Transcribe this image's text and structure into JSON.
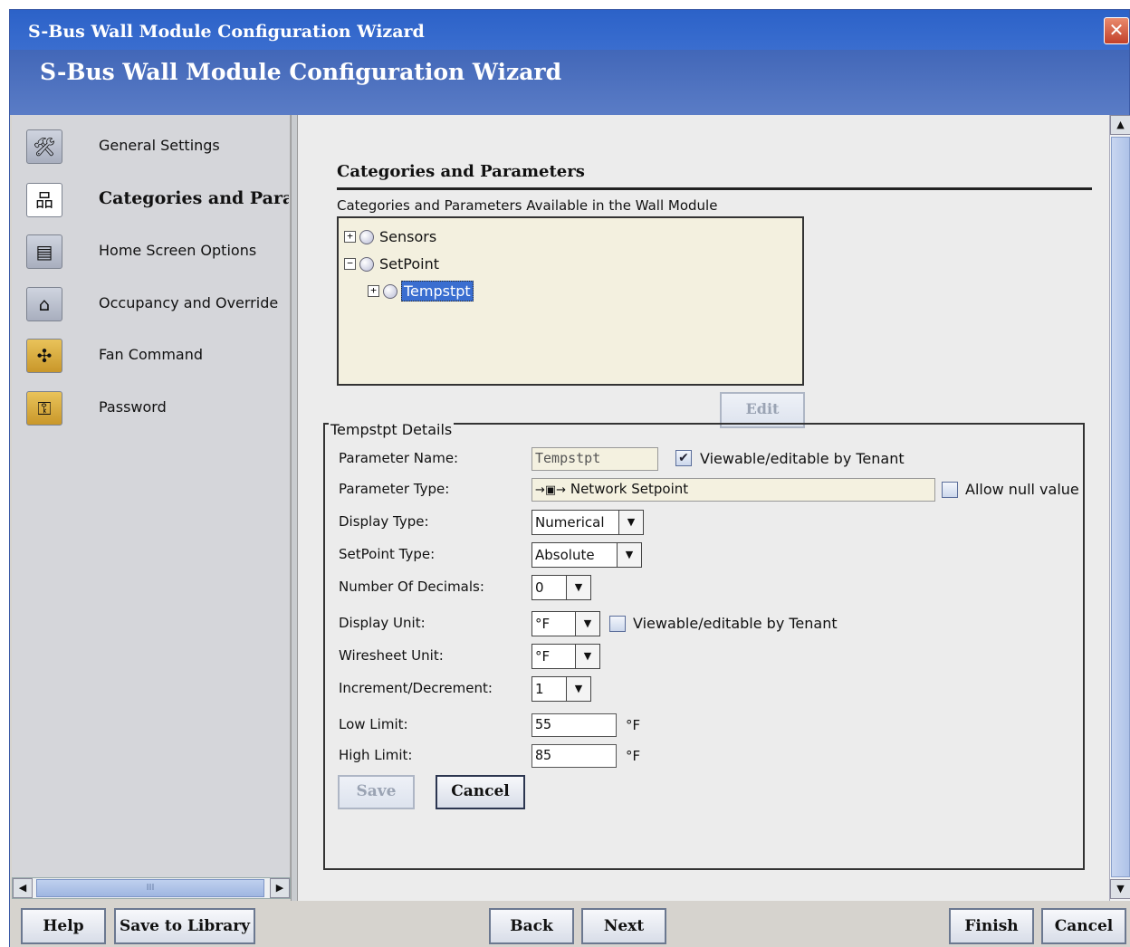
{
  "window": {
    "title": "S-Bus Wall Module Configuration Wizard",
    "header_title": "S-Bus Wall Module Configuration Wizard",
    "close_glyph": "✕"
  },
  "sidebar": {
    "items": [
      {
        "label": "General Settings",
        "icon": "settings-icon"
      },
      {
        "label": "Categories and Parameters",
        "icon": "hierarchy-icon",
        "active": true
      },
      {
        "label": "Home Screen Options",
        "icon": "home-screen-icon"
      },
      {
        "label": "Occupancy and Override",
        "icon": "occupancy-icon"
      },
      {
        "label": "Fan Command",
        "icon": "fan-icon"
      },
      {
        "label": "Password",
        "icon": "key-icon"
      }
    ],
    "scroll_grip": "III"
  },
  "main": {
    "section_title": "Categories and Parameters",
    "tree_caption": "Categories and Parameters Available in the Wall Module",
    "tree": [
      {
        "label": "Sensors",
        "expander": "+",
        "level": 0
      },
      {
        "label": "SetPoint",
        "expander": "−",
        "level": 0
      },
      {
        "label": "Tempstpt",
        "expander": "+",
        "level": 1,
        "selected": true
      }
    ],
    "edit_label": "Edit"
  },
  "details": {
    "legend": "Tempstpt Details",
    "parameter_name_label": "Parameter Name:",
    "parameter_name_value": "Tempstpt",
    "viewable_tenant_label": "Viewable/editable by Tenant",
    "viewable_tenant_checked": "✔",
    "parameter_type_label": "Parameter Type:",
    "parameter_type_value": "Network Setpoint",
    "allow_null_label": "Allow null value",
    "display_type_label": "Display Type:",
    "display_type_value": "Numerical",
    "setpoint_type_label": "SetPoint Type:",
    "setpoint_type_value": "Absolute",
    "decimals_label": "Number Of Decimals:",
    "decimals_value": "0",
    "display_unit_label": "Display Unit:",
    "display_unit_value": "°F",
    "display_unit_viewable_label": "Viewable/editable by Tenant",
    "wiresheet_unit_label": "Wiresheet Unit:",
    "wiresheet_unit_value": "°F",
    "increment_label": "Increment/Decrement:",
    "increment_value": "1",
    "low_limit_label": "Low Limit:",
    "low_limit_value": "55",
    "low_limit_unit": "°F",
    "high_limit_label": "High Limit:",
    "high_limit_value": "85",
    "high_limit_unit": "°F",
    "save_label": "Save",
    "cancel_label": "Cancel"
  },
  "footer": {
    "help": "Help",
    "save_library": "Save to Library",
    "back": "Back",
    "next": "Next",
    "finish": "Finish",
    "cancel": "Cancel"
  }
}
